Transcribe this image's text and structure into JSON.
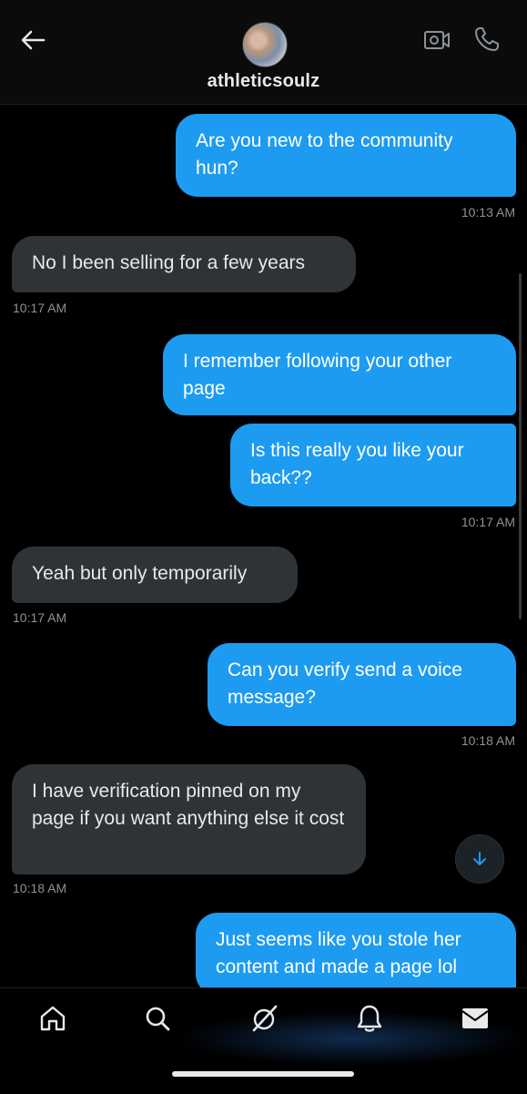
{
  "header": {
    "username": "athleticsoulz",
    "icons": {
      "back": "arrow-left-icon",
      "video": "video-call-icon",
      "phone": "phone-call-icon"
    }
  },
  "messages": [
    {
      "type": "sent",
      "text": "Are you new to the community hun?",
      "time": "10:13 AM"
    },
    {
      "type": "received",
      "text": "No I been selling for a few years",
      "time": "10:17 AM"
    },
    {
      "type": "sent",
      "text": "I remember following your other page",
      "time": ""
    },
    {
      "type": "sent",
      "text": "Is this really you like your back??",
      "time": "10:17 AM"
    },
    {
      "type": "received",
      "text": "Yeah but only temporarily",
      "time": "10:17 AM"
    },
    {
      "type": "sent",
      "text": "Can you verify send a voice message?",
      "time": "10:18 AM"
    },
    {
      "type": "received",
      "text": "I have verification pinned on my page if you want anything else it cost",
      "time": "10:18 AM"
    },
    {
      "type": "sent",
      "text": "Just seems like you stole her content and made a page lol",
      "time": ""
    }
  ],
  "bottom_nav": [
    "home-icon",
    "search-icon",
    "grok-icon",
    "notifications-bell-icon",
    "messages-envelope-icon"
  ],
  "colors": {
    "sent_bubble": "#1d9bf0",
    "received_bubble": "#2f3336",
    "background": "#000000",
    "timestamp": "#8b9399"
  }
}
